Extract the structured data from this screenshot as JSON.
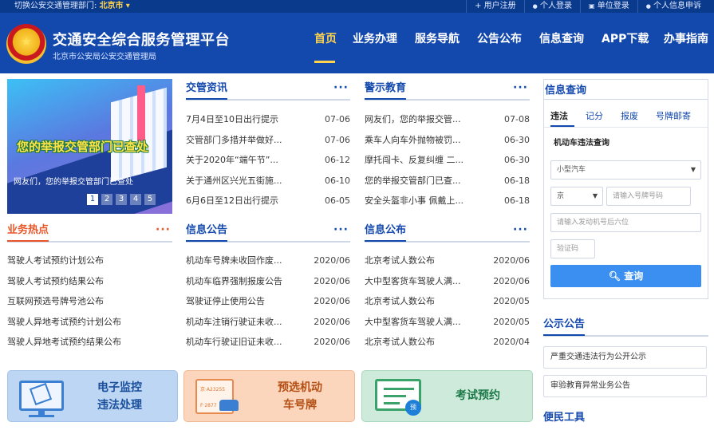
{
  "topbar": {
    "dept_label": "切换公安交通管理部门:",
    "dept_value": "北京市",
    "dept_arrow": "▾",
    "links": [
      {
        "icon": "plus-icon",
        "glyph": "+",
        "label": "用户注册"
      },
      {
        "icon": "user-icon",
        "glyph": "●",
        "label": "个人登录"
      },
      {
        "icon": "building-icon",
        "glyph": "▣",
        "label": "单位登录"
      },
      {
        "icon": "profile-icon",
        "glyph": "●",
        "label": "个人信息申诉"
      }
    ]
  },
  "header": {
    "title": "交通安全综合服务管理平台",
    "subtitle": "北京市公安局公安交通管理局",
    "emblem": "police-emblem-icon"
  },
  "nav": [
    "首页",
    "业务办理",
    "服务导航",
    "公告公布",
    "信息查询",
    "APP下载",
    "办事指南"
  ],
  "banner": {
    "headline": "您的举报交管部门已查处",
    "caption": "网友们，您的举报交管部门已查处",
    "dots": [
      "1",
      "2",
      "3",
      "4",
      "5"
    ],
    "active_dot": "1"
  },
  "news": {
    "title": "交管资讯",
    "more": "···",
    "items": [
      {
        "text": "7月4日至10日出行提示",
        "date": "07-06"
      },
      {
        "text": "交管部门多措并举做好...",
        "date": "07-06"
      },
      {
        "text": "关于2020年“端午节”...",
        "date": "06-12"
      },
      {
        "text": "关于通州区兴光五街施...",
        "date": "06-10"
      },
      {
        "text": "6月6日至12日出行提示",
        "date": "06-05"
      }
    ]
  },
  "warning": {
    "title": "警示教育",
    "more": "···",
    "items": [
      {
        "text": "网友们，您的举报交管...",
        "date": "07-08"
      },
      {
        "text": "乘车人向车外抛物被罚...",
        "date": "06-30"
      },
      {
        "text": "摩托闯卡、反复纠缠 二...",
        "date": "06-30"
      },
      {
        "text": "您的举报交管部门已查...",
        "date": "06-18"
      },
      {
        "text": "安全头盔非小事 佩戴上...",
        "date": "06-18"
      }
    ]
  },
  "hot": {
    "title": "业务热点",
    "more": "···",
    "items": [
      {
        "text": "驾驶人考试预约计划公布"
      },
      {
        "text": "驾驶人考试预约结果公布"
      },
      {
        "text": "互联网预选号牌号池公布"
      },
      {
        "text": "驾驶人异地考试预约计划公布"
      },
      {
        "text": "驾驶人异地考试预约结果公布"
      }
    ]
  },
  "info_notice": {
    "title": "信息公告",
    "more": "···",
    "items": [
      {
        "text": "机动车号牌未收回作废...",
        "date": "2020/06"
      },
      {
        "text": "机动车临界强制报废公告",
        "date": "2020/06"
      },
      {
        "text": "驾驶证停止使用公告",
        "date": "2020/06"
      },
      {
        "text": "机动车注销行驶证未收...",
        "date": "2020/06"
      },
      {
        "text": "机动车行驶证旧证未收...",
        "date": "2020/06"
      }
    ]
  },
  "info_pub": {
    "title": "信息公布",
    "more": "···",
    "items": [
      {
        "text": "北京考试人数公布",
        "date": "2020/06"
      },
      {
        "text": "大中型客货车驾驶人满...",
        "date": "2020/06"
      },
      {
        "text": "北京考试人数公布",
        "date": "2020/05"
      },
      {
        "text": "大中型客货车驾驶人满...",
        "date": "2020/05"
      },
      {
        "text": "北京考试人数公布",
        "date": "2020/04"
      }
    ]
  },
  "query": {
    "title": "信息查询",
    "tabs": [
      "违法",
      "记分",
      "报废",
      "号牌邮寄"
    ],
    "active_tab": "违法",
    "subtitle": "机动车违法查询",
    "vehicle_type": "小型汽车",
    "province": "京",
    "plate_placeholder": "请输入号牌号码",
    "engine_placeholder": "请输入发动机号后六位",
    "captcha_placeholder": "验证码",
    "button": "查询"
  },
  "public_notice": {
    "title": "公示公告",
    "items": [
      "严重交通违法行为公开公示",
      "审验教育异常业务公告"
    ]
  },
  "convenience": {
    "title": "便民工具"
  },
  "tiles": [
    {
      "line1": "电子监控",
      "line2": "违法处理"
    },
    {
      "line1": "预选机动",
      "line2": "车号牌",
      "plate_a": "京·A23255",
      "plate_b": "F·2877"
    },
    {
      "line1": "考试预约",
      "seal": "预"
    }
  ]
}
